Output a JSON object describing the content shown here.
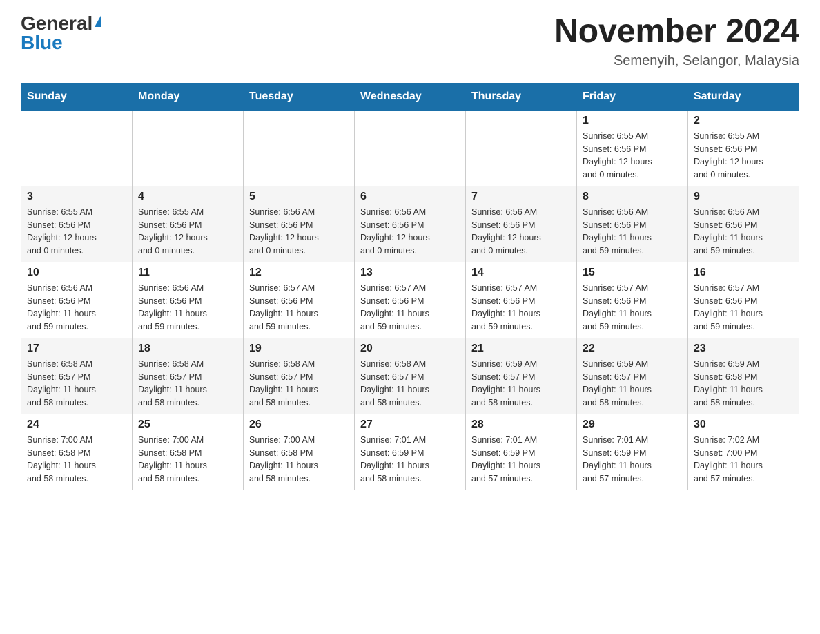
{
  "logo": {
    "general": "General",
    "blue": "Blue"
  },
  "title": "November 2024",
  "location": "Semenyih, Selangor, Malaysia",
  "days_of_week": [
    "Sunday",
    "Monday",
    "Tuesday",
    "Wednesday",
    "Thursday",
    "Friday",
    "Saturday"
  ],
  "weeks": [
    [
      {
        "day": "",
        "info": ""
      },
      {
        "day": "",
        "info": ""
      },
      {
        "day": "",
        "info": ""
      },
      {
        "day": "",
        "info": ""
      },
      {
        "day": "",
        "info": ""
      },
      {
        "day": "1",
        "info": "Sunrise: 6:55 AM\nSunset: 6:56 PM\nDaylight: 12 hours\nand 0 minutes."
      },
      {
        "day": "2",
        "info": "Sunrise: 6:55 AM\nSunset: 6:56 PM\nDaylight: 12 hours\nand 0 minutes."
      }
    ],
    [
      {
        "day": "3",
        "info": "Sunrise: 6:55 AM\nSunset: 6:56 PM\nDaylight: 12 hours\nand 0 minutes."
      },
      {
        "day": "4",
        "info": "Sunrise: 6:55 AM\nSunset: 6:56 PM\nDaylight: 12 hours\nand 0 minutes."
      },
      {
        "day": "5",
        "info": "Sunrise: 6:56 AM\nSunset: 6:56 PM\nDaylight: 12 hours\nand 0 minutes."
      },
      {
        "day": "6",
        "info": "Sunrise: 6:56 AM\nSunset: 6:56 PM\nDaylight: 12 hours\nand 0 minutes."
      },
      {
        "day": "7",
        "info": "Sunrise: 6:56 AM\nSunset: 6:56 PM\nDaylight: 12 hours\nand 0 minutes."
      },
      {
        "day": "8",
        "info": "Sunrise: 6:56 AM\nSunset: 6:56 PM\nDaylight: 11 hours\nand 59 minutes."
      },
      {
        "day": "9",
        "info": "Sunrise: 6:56 AM\nSunset: 6:56 PM\nDaylight: 11 hours\nand 59 minutes."
      }
    ],
    [
      {
        "day": "10",
        "info": "Sunrise: 6:56 AM\nSunset: 6:56 PM\nDaylight: 11 hours\nand 59 minutes."
      },
      {
        "day": "11",
        "info": "Sunrise: 6:56 AM\nSunset: 6:56 PM\nDaylight: 11 hours\nand 59 minutes."
      },
      {
        "day": "12",
        "info": "Sunrise: 6:57 AM\nSunset: 6:56 PM\nDaylight: 11 hours\nand 59 minutes."
      },
      {
        "day": "13",
        "info": "Sunrise: 6:57 AM\nSunset: 6:56 PM\nDaylight: 11 hours\nand 59 minutes."
      },
      {
        "day": "14",
        "info": "Sunrise: 6:57 AM\nSunset: 6:56 PM\nDaylight: 11 hours\nand 59 minutes."
      },
      {
        "day": "15",
        "info": "Sunrise: 6:57 AM\nSunset: 6:56 PM\nDaylight: 11 hours\nand 59 minutes."
      },
      {
        "day": "16",
        "info": "Sunrise: 6:57 AM\nSunset: 6:56 PM\nDaylight: 11 hours\nand 59 minutes."
      }
    ],
    [
      {
        "day": "17",
        "info": "Sunrise: 6:58 AM\nSunset: 6:57 PM\nDaylight: 11 hours\nand 58 minutes."
      },
      {
        "day": "18",
        "info": "Sunrise: 6:58 AM\nSunset: 6:57 PM\nDaylight: 11 hours\nand 58 minutes."
      },
      {
        "day": "19",
        "info": "Sunrise: 6:58 AM\nSunset: 6:57 PM\nDaylight: 11 hours\nand 58 minutes."
      },
      {
        "day": "20",
        "info": "Sunrise: 6:58 AM\nSunset: 6:57 PM\nDaylight: 11 hours\nand 58 minutes."
      },
      {
        "day": "21",
        "info": "Sunrise: 6:59 AM\nSunset: 6:57 PM\nDaylight: 11 hours\nand 58 minutes."
      },
      {
        "day": "22",
        "info": "Sunrise: 6:59 AM\nSunset: 6:57 PM\nDaylight: 11 hours\nand 58 minutes."
      },
      {
        "day": "23",
        "info": "Sunrise: 6:59 AM\nSunset: 6:58 PM\nDaylight: 11 hours\nand 58 minutes."
      }
    ],
    [
      {
        "day": "24",
        "info": "Sunrise: 7:00 AM\nSunset: 6:58 PM\nDaylight: 11 hours\nand 58 minutes."
      },
      {
        "day": "25",
        "info": "Sunrise: 7:00 AM\nSunset: 6:58 PM\nDaylight: 11 hours\nand 58 minutes."
      },
      {
        "day": "26",
        "info": "Sunrise: 7:00 AM\nSunset: 6:58 PM\nDaylight: 11 hours\nand 58 minutes."
      },
      {
        "day": "27",
        "info": "Sunrise: 7:01 AM\nSunset: 6:59 PM\nDaylight: 11 hours\nand 58 minutes."
      },
      {
        "day": "28",
        "info": "Sunrise: 7:01 AM\nSunset: 6:59 PM\nDaylight: 11 hours\nand 57 minutes."
      },
      {
        "day": "29",
        "info": "Sunrise: 7:01 AM\nSunset: 6:59 PM\nDaylight: 11 hours\nand 57 minutes."
      },
      {
        "day": "30",
        "info": "Sunrise: 7:02 AM\nSunset: 7:00 PM\nDaylight: 11 hours\nand 57 minutes."
      }
    ]
  ]
}
